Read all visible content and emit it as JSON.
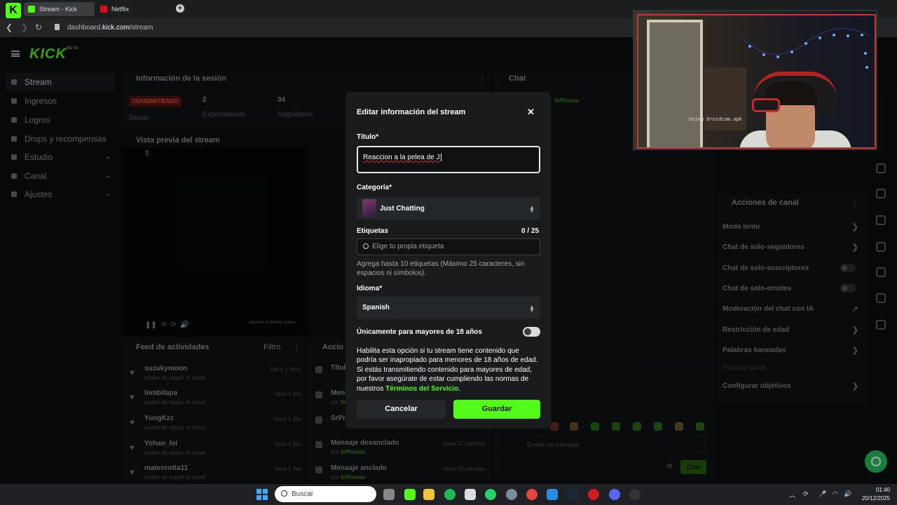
{
  "browser": {
    "tab_count": "3",
    "tabs": [
      {
        "label": "Stream - Kick Dashboard"
      },
      {
        "label": "Netflix"
      }
    ],
    "url_prefix": "dashboard.",
    "url_domain": "kick.com",
    "url_path": "/stream"
  },
  "brand": {
    "logo": "KICK",
    "beta": "BETA",
    "accent": "#53fc18"
  },
  "sidebar": {
    "items": [
      {
        "label": "Stream",
        "icon": "stream-icon"
      },
      {
        "label": "Ingresos",
        "icon": "revenue-icon"
      },
      {
        "label": "Logros",
        "icon": "trophy-icon"
      },
      {
        "label": "Drops y recompensas",
        "icon": "gift-icon"
      },
      {
        "label": "Estudio",
        "icon": "studio-icon"
      },
      {
        "label": "Canal",
        "icon": "channel-icon"
      },
      {
        "label": "Ajustes",
        "icon": "gear-icon"
      }
    ]
  },
  "session": {
    "title": "Información de la sesión",
    "status": "TRANSMITIENDO",
    "status_label": "Sesión",
    "viewers": "2",
    "viewers_label": "Espectadores",
    "followers": "34",
    "followers_label": "Seguidores"
  },
  "preview": {
    "title": "Vista previa del stream",
    "viewer_badge": "3",
    "caption": "Jake Paul vs. Anthony Joshua"
  },
  "feed": {
    "title": "Feed de actividades",
    "filter": "Filtro",
    "items": [
      {
        "user": "suzukymoon",
        "action": "acaba de seguir el canal",
        "ago": "hace 1 hora"
      },
      {
        "user": "lombitapa",
        "action": "acaba de seguir el canal",
        "ago": "hace 1 día"
      },
      {
        "user": "YungKzz",
        "action": "acaba de seguir el canal",
        "ago": "hace 1 día"
      },
      {
        "user": "Yohan_loi",
        "action": "acaba de seguir el canal",
        "ago": "hace 1 día"
      },
      {
        "user": "mateorotta11",
        "action": "acaba de seguir el canal",
        "ago": "hace 1 día"
      }
    ]
  },
  "accion": {
    "title": "Accio",
    "items": [
      {
        "title": "Títul",
        "by": "",
        "ago": ""
      },
      {
        "title": "Mens",
        "by": "SrPi",
        "ago": ""
      },
      {
        "title": "SrPi",
        "by": "",
        "ago": ""
      },
      {
        "title": "Mensaje desanclado",
        "by": "SrPinooo",
        "ago": "hace 37 minutos"
      },
      {
        "title": "Mensaje anclado",
        "by": "SrPinooo",
        "ago": "hace 50 minutos"
      }
    ]
  },
  "chat": {
    "title": "Chat",
    "user": "SrPinooo",
    "placeholder": "Enviar un mensaje",
    "send": "Chat"
  },
  "channel_actions": {
    "title": "Acciones de canal",
    "items": [
      {
        "label": "Modo lento",
        "control": "chevron"
      },
      {
        "label": "Chat de solo-seguidores",
        "control": "chevron"
      },
      {
        "label": "Chat de solo-suscriptores",
        "control": "toggle"
      },
      {
        "label": "Chat de solo-emotes",
        "control": "toggle"
      },
      {
        "label": "Moderación del chat con IA",
        "control": "external"
      },
      {
        "label": "Restricción de edad",
        "control": "chevron"
      },
      {
        "label": "Palabras baneadas",
        "control": "chevron"
      },
      {
        "label": "Hostear canal",
        "control": "none"
      },
      {
        "label": "Configurar objetivos",
        "control": "chevron"
      }
    ]
  },
  "modal": {
    "title": "Editar información del stream",
    "title_label": "Título*",
    "title_value": "Reaccion a la pelea de J",
    "category_label": "Categoría*",
    "category_value": "Just Chatting",
    "tags_label": "Etiquetas",
    "tags_count": "0 / 25",
    "tags_placeholder": "Elige tu propia etiqueta",
    "tags_hint": "Agrega hasta 10 etiquetas (Máximo 25 caracteres, sin espacios ni símbolos).",
    "language_label": "Idioma*",
    "language_value": "Spanish",
    "adult_label": "Únicamente para mayores de 18 años",
    "adult_enabled": false,
    "adult_desc": "Habilita esta opción si tu stream tiene contenido que podría ser inapropiado para menores de 18 años de edad. Si estás transmitiendo contenido para mayores de edad, por favor asegúrate de estar cumpliendo las normas de nuestros",
    "terms_link": "Términos del Servicio",
    "terms_end": ".",
    "cancel": "Cancelar",
    "save": "Guardar"
  },
  "webcam": {
    "watermark": "Using Droidcam.apk"
  },
  "taskbar": {
    "search_placeholder": "Buscar",
    "time": "01:40",
    "date": "20/12/2025"
  }
}
